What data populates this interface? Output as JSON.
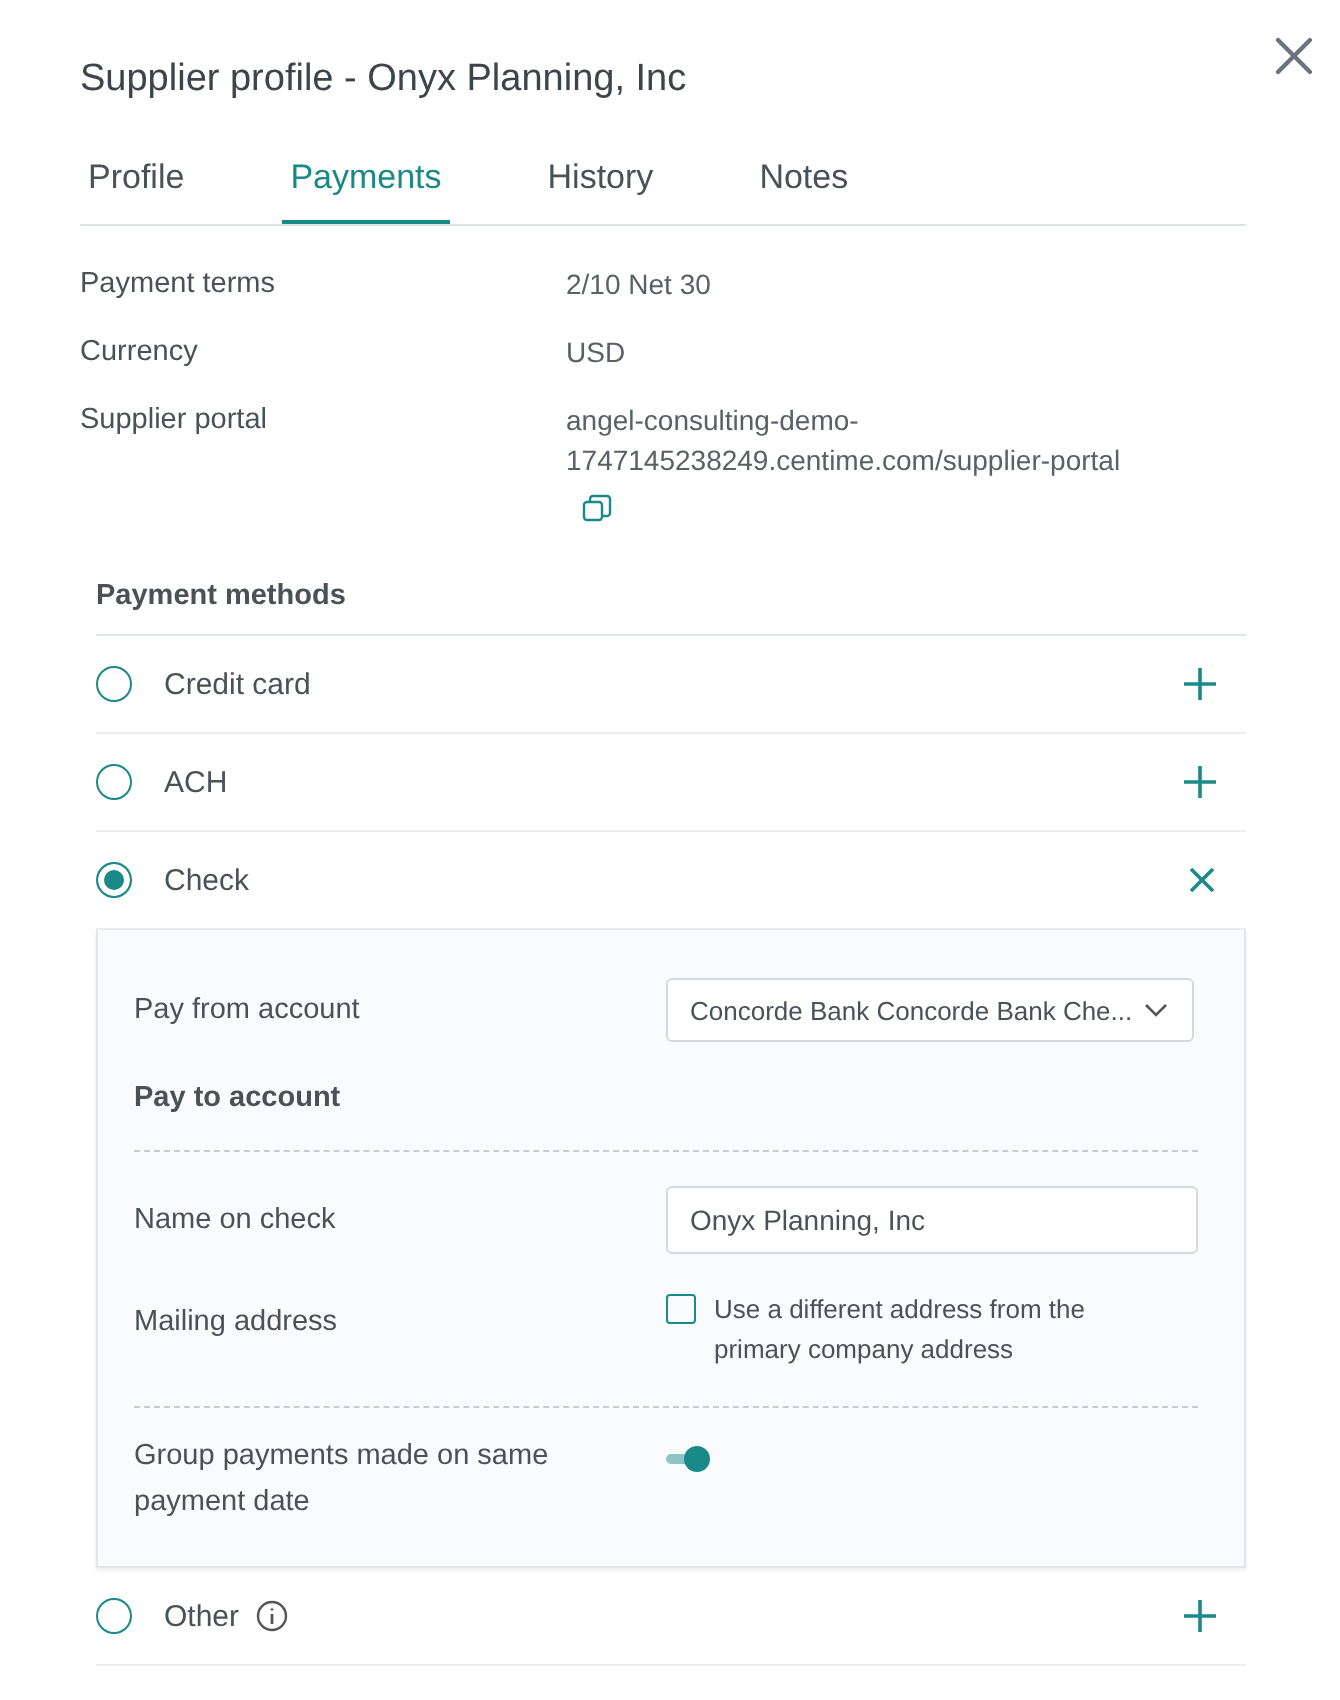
{
  "title": "Supplier profile - Onyx Planning, Inc",
  "tabs": [
    {
      "label": "Profile",
      "selected": false
    },
    {
      "label": "Payments",
      "selected": true
    },
    {
      "label": "History",
      "selected": false
    },
    {
      "label": "Notes",
      "selected": false
    }
  ],
  "details": [
    {
      "label": "Payment terms",
      "value": "2/10 Net 30"
    },
    {
      "label": "Currency",
      "value": "USD"
    },
    {
      "label": "Supplier portal",
      "value": "angel-consulting-demo-1747145238249.centime.com/supplier-portal",
      "copyable": true
    }
  ],
  "payment_methods": {
    "heading": "Payment methods",
    "items": [
      {
        "label": "Credit card",
        "selected": false
      },
      {
        "label": "ACH",
        "selected": false
      },
      {
        "label": "Check",
        "selected": true,
        "details": {
          "pay_from": {
            "label": "Pay from account",
            "value": "Concorde Bank Concorde Bank Che..."
          },
          "pay_to_heading": "Pay to account",
          "name_on_check": {
            "label": "Name on check",
            "value": "Onyx Planning, Inc"
          },
          "mailing_address": {
            "label": "Mailing address",
            "option": "Use a different address from the primary company address",
            "checked": false
          },
          "group_payments": {
            "label": "Group payments made on same payment date",
            "on": true
          }
        }
      },
      {
        "label": "Other",
        "selected": false,
        "info": true
      }
    ]
  }
}
